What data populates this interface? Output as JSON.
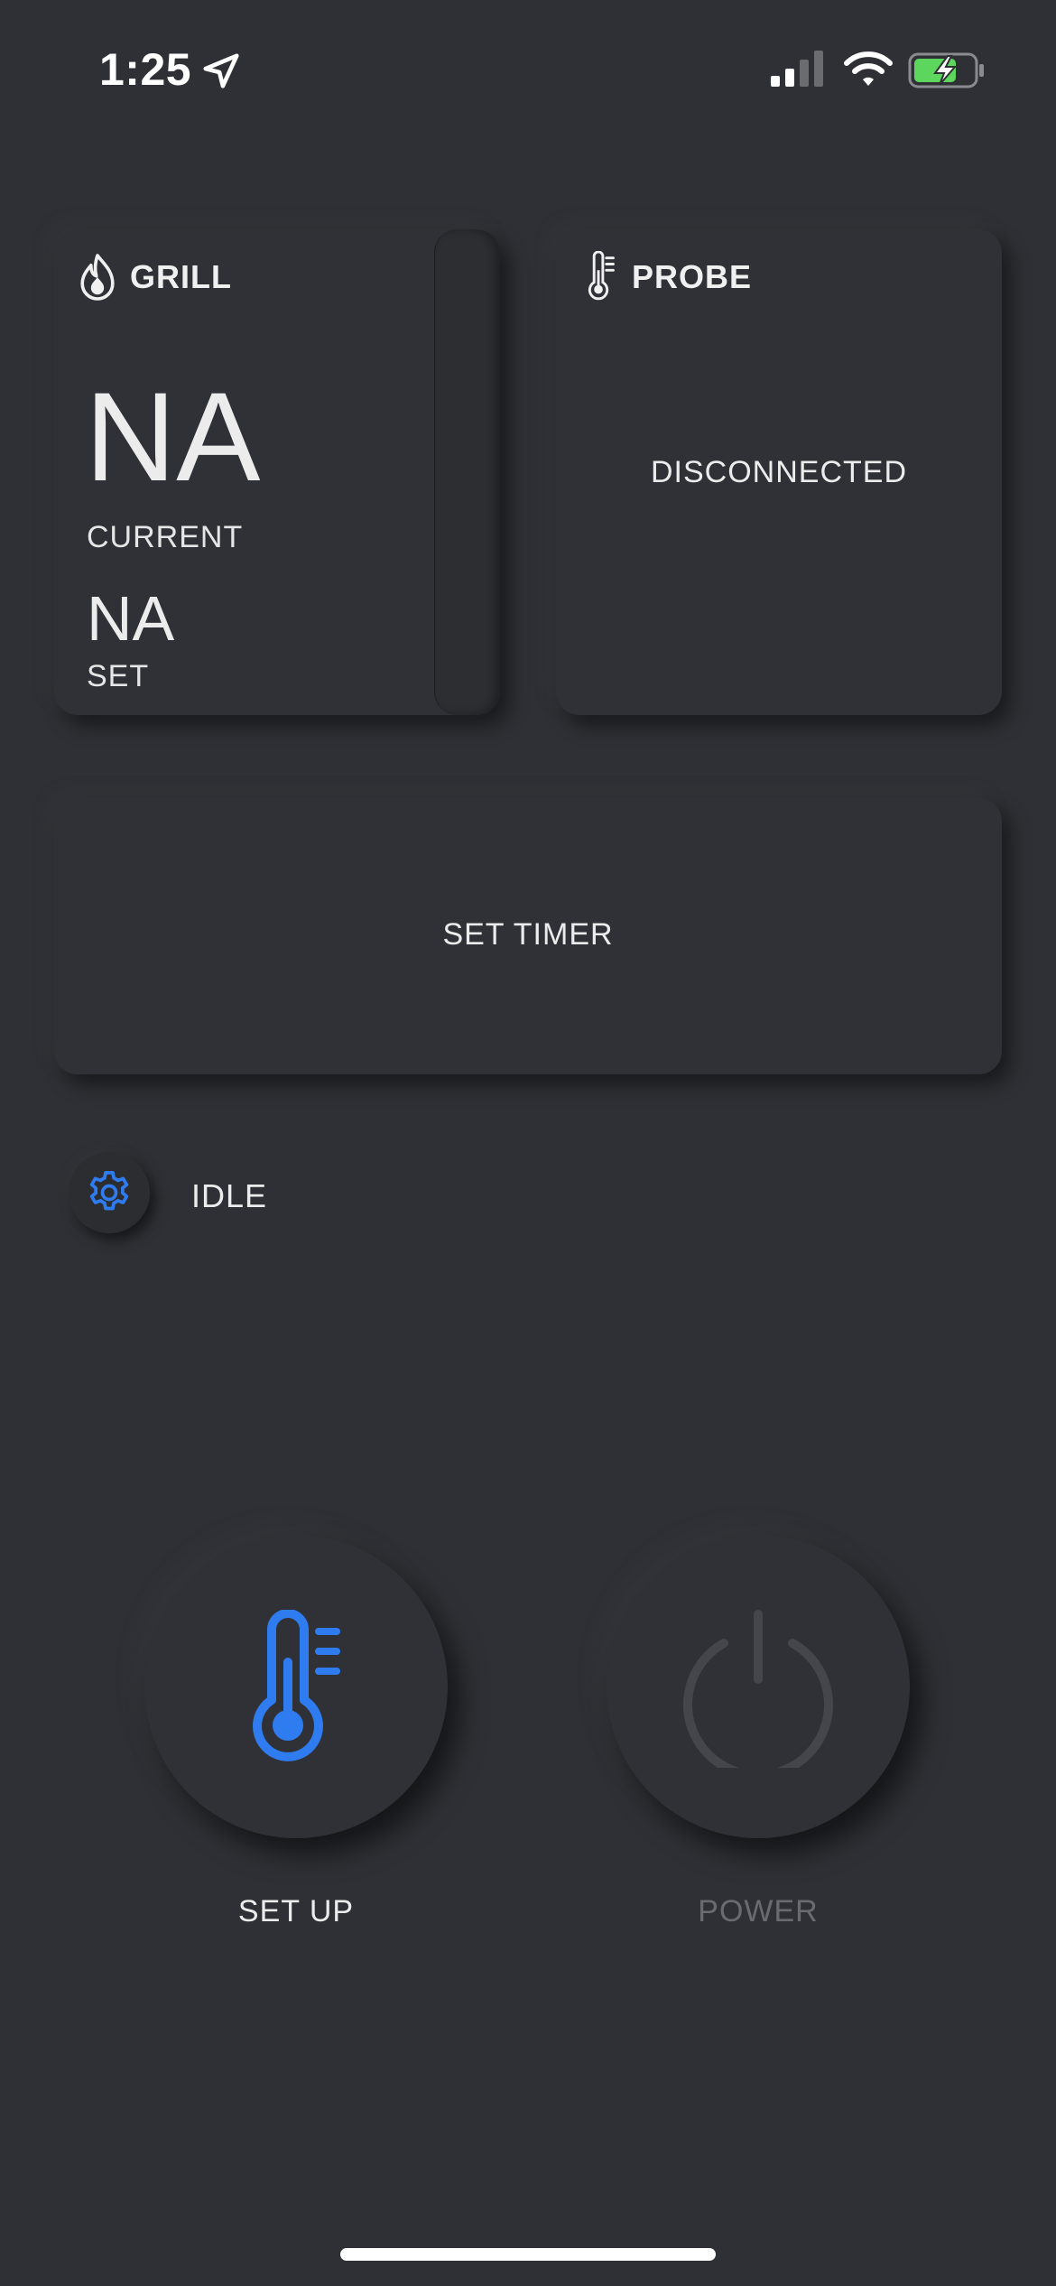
{
  "status_bar": {
    "time": "1:25",
    "icons": [
      "location-arrow-icon",
      "cellular-signal-icon",
      "wifi-icon",
      "battery-charging-icon"
    ]
  },
  "grill_card": {
    "title": "GRILL",
    "icon": "flame-icon",
    "current_value": "NA",
    "current_label": "CURRENT",
    "set_value": "NA",
    "set_label": "SET"
  },
  "probe_card": {
    "title": "PROBE",
    "icon": "thermometer-icon",
    "status": "DISCONNECTED"
  },
  "timer_card": {
    "label": "SET TIMER"
  },
  "state_row": {
    "icon": "gear-icon",
    "status": "IDLE"
  },
  "controls": {
    "setup_label": "SET UP",
    "setup_icon": "thermometer-icon",
    "power_label": "POWER",
    "power_icon": "power-icon"
  },
  "colors": {
    "background": "#2f3035",
    "accent": "#2f7cf0",
    "disabled": "#45464b",
    "battery_fill": "#5cd65c"
  }
}
